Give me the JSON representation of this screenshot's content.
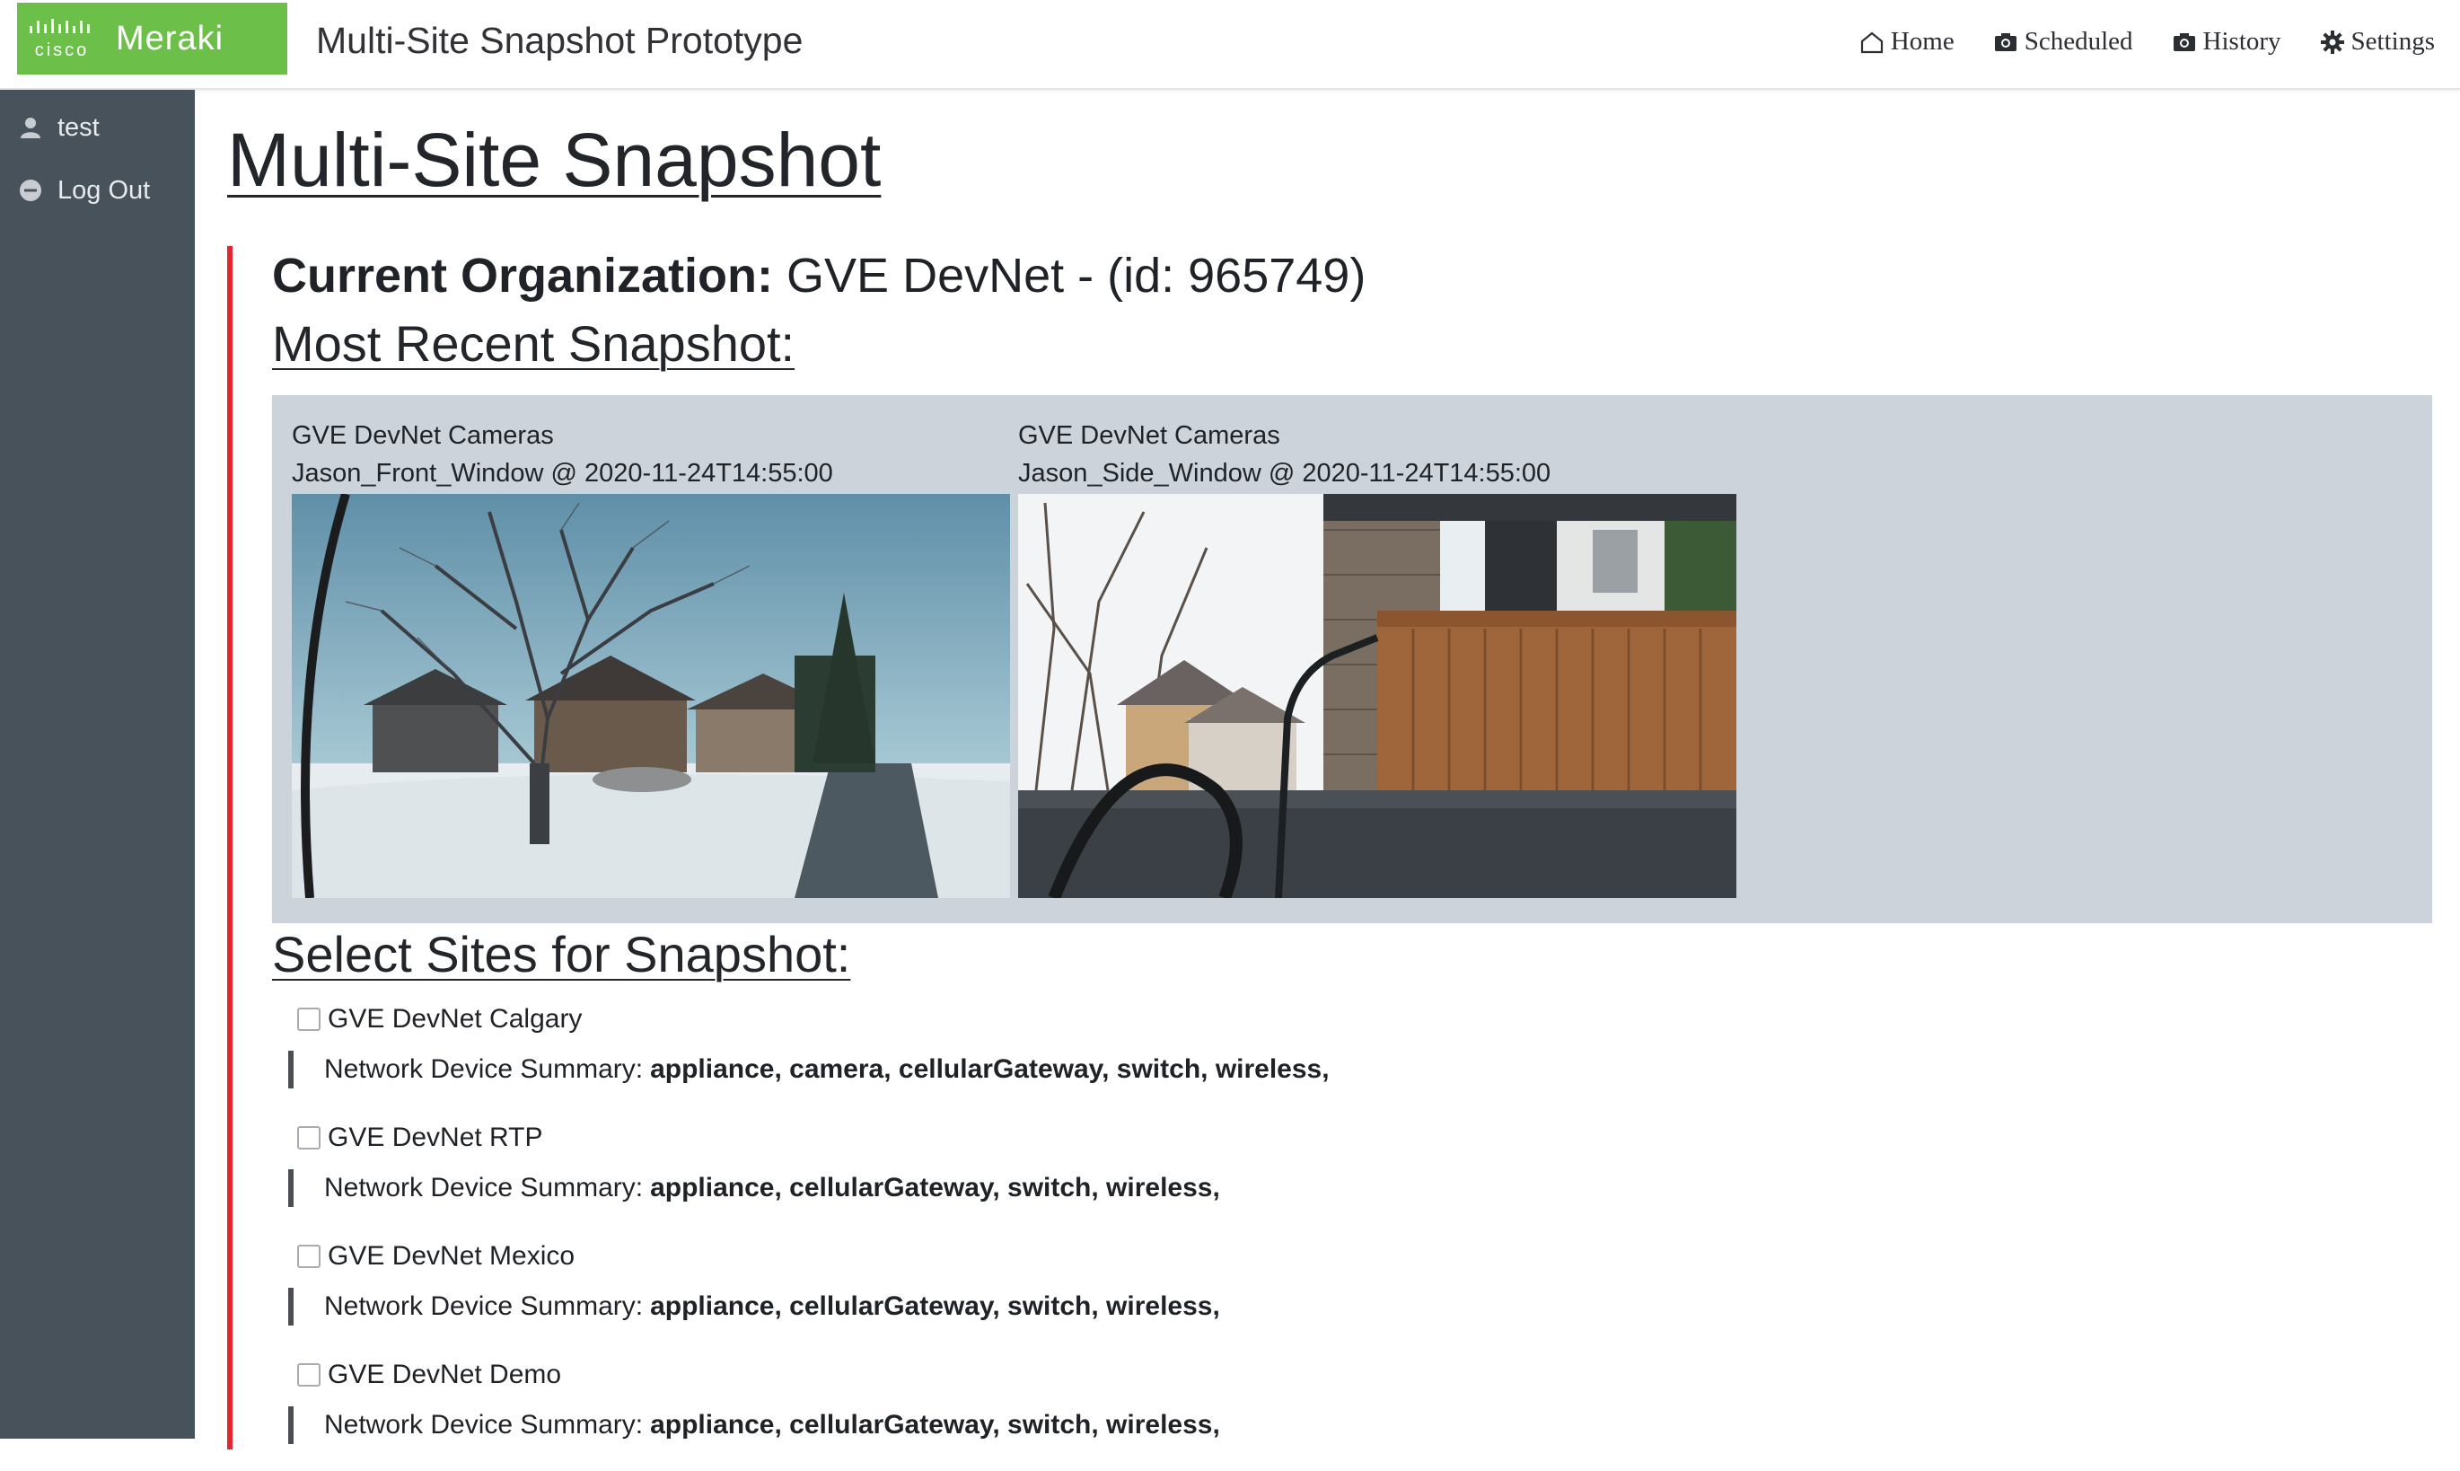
{
  "header": {
    "brand": "Meraki",
    "brand_small": "cisco",
    "app_title": "Multi-Site Snapshot Prototype",
    "nav": [
      {
        "label": "Home",
        "icon": "home-icon"
      },
      {
        "label": "Scheduled",
        "icon": "camera-icon"
      },
      {
        "label": "History",
        "icon": "camera-icon"
      },
      {
        "label": "Settings",
        "icon": "gear-icon"
      }
    ]
  },
  "sidebar": {
    "items": [
      {
        "label": "test",
        "icon": "user-icon"
      },
      {
        "label": "Log Out",
        "icon": "minus-circle-icon"
      }
    ]
  },
  "main": {
    "title": "Multi-Site Snapshot",
    "org_label": "Current Organization:",
    "org_value": "GVE DevNet - (id: 965749)",
    "recent_heading": "Most Recent Snapshot:",
    "snapshots": [
      {
        "network": "GVE DevNet Cameras",
        "camera": "Jason_Front_Window @ 2020-11-24T14:55:00"
      },
      {
        "network": "GVE DevNet Cameras",
        "camera": "Jason_Side_Window @ 2020-11-24T14:55:00"
      }
    ],
    "select_heading": "Select Sites for Snapshot:",
    "summary_label": "Network Device Summary:",
    "sites": [
      {
        "name": "GVE DevNet Calgary",
        "devices": "appliance, camera, cellularGateway, switch, wireless,"
      },
      {
        "name": "GVE DevNet RTP",
        "devices": "appliance, cellularGateway, switch, wireless,"
      },
      {
        "name": "GVE DevNet Mexico",
        "devices": "appliance, cellularGateway, switch, wireless,"
      },
      {
        "name": "GVE DevNet Demo",
        "devices": "appliance, cellularGateway, switch, wireless,"
      }
    ]
  },
  "colors": {
    "brand_green": "#6cc04a",
    "accent_red": "#e4262d",
    "sidebar": "#48525a",
    "panel": "#cdd3da"
  }
}
